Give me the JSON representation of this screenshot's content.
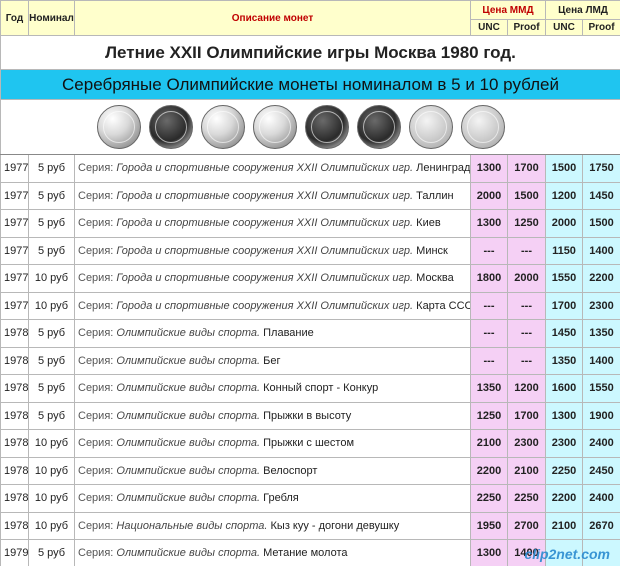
{
  "header": {
    "year": "Год",
    "nominal": "Номинал",
    "description": "Описание монет",
    "mmd_price": "Цена ММД",
    "lmd_price": "Цена ЛМД",
    "unc": "UNC",
    "proof": "Proof"
  },
  "title": "Летние XXII Олимпийские игры Москва 1980 год.",
  "subtitle": "Серебряные Олимпийские монеты номиналом в 5 и 10 рублей",
  "series_prefix": "Серия:",
  "rows": [
    {
      "year": "1977",
      "nominal": "5 руб",
      "series": "Города и спортивные сооружения XXII Олимпийских игр.",
      "name": "Ленинград",
      "mmd_unc": "1300",
      "mmd_proof": "1700",
      "lmd_unc": "1500",
      "lmd_proof": "1750"
    },
    {
      "year": "1977",
      "nominal": "5 руб",
      "series": "Города и спортивные сооружения XXII Олимпийских игр.",
      "name": "Таллин",
      "mmd_unc": "2000",
      "mmd_proof": "1500",
      "lmd_unc": "1200",
      "lmd_proof": "1450"
    },
    {
      "year": "1977",
      "nominal": "5 руб",
      "series": "Города и спортивные сооружения XXII Олимпийских игр.",
      "name": "Киев",
      "mmd_unc": "1300",
      "mmd_proof": "1250",
      "lmd_unc": "2000",
      "lmd_proof": "1500"
    },
    {
      "year": "1977",
      "nominal": "5 руб",
      "series": "Города и спортивные сооружения XXII Олимпийских игр.",
      "name": "Минск",
      "mmd_unc": "---",
      "mmd_proof": "---",
      "lmd_unc": "1150",
      "lmd_proof": "1400"
    },
    {
      "year": "1977",
      "nominal": "10 руб",
      "series": "Города и спортивные сооружения XXII Олимпийских игр.",
      "name": "Москва",
      "mmd_unc": "1800",
      "mmd_proof": "2000",
      "lmd_unc": "1550",
      "lmd_proof": "2200"
    },
    {
      "year": "1977",
      "nominal": "10 руб",
      "series": "Города и спортивные сооружения XXII Олимпийских игр.",
      "name": "Карта СССР",
      "mmd_unc": "---",
      "mmd_proof": "---",
      "lmd_unc": "1700",
      "lmd_proof": "2300"
    },
    {
      "year": "1978",
      "nominal": "5 руб",
      "series": "Олимпийские виды спорта.",
      "name": "Плавание",
      "mmd_unc": "---",
      "mmd_proof": "---",
      "lmd_unc": "1450",
      "lmd_proof": "1350"
    },
    {
      "year": "1978",
      "nominal": "5 руб",
      "series": "Олимпийские виды спорта.",
      "name": "Бег",
      "mmd_unc": "---",
      "mmd_proof": "---",
      "lmd_unc": "1350",
      "lmd_proof": "1400"
    },
    {
      "year": "1978",
      "nominal": "5 руб",
      "series": "Олимпийские виды спорта.",
      "name": "Конный спорт - Конкур",
      "mmd_unc": "1350",
      "mmd_proof": "1200",
      "lmd_unc": "1600",
      "lmd_proof": "1550"
    },
    {
      "year": "1978",
      "nominal": "5 руб",
      "series": "Олимпийские виды спорта.",
      "name": "Прыжки в высоту",
      "mmd_unc": "1250",
      "mmd_proof": "1700",
      "lmd_unc": "1300",
      "lmd_proof": "1900"
    },
    {
      "year": "1978",
      "nominal": "10 руб",
      "series": "Олимпийские виды спорта.",
      "name": "Прыжки с шестом",
      "mmd_unc": "2100",
      "mmd_proof": "2300",
      "lmd_unc": "2300",
      "lmd_proof": "2400"
    },
    {
      "year": "1978",
      "nominal": "10 руб",
      "series": "Олимпийские виды спорта.",
      "name": "Велоспорт",
      "mmd_unc": "2200",
      "mmd_proof": "2100",
      "lmd_unc": "2250",
      "lmd_proof": "2450"
    },
    {
      "year": "1978",
      "nominal": "10 руб",
      "series": "Олимпийские виды спорта.",
      "name": "Гребля",
      "mmd_unc": "2250",
      "mmd_proof": "2250",
      "lmd_unc": "2200",
      "lmd_proof": "2400"
    },
    {
      "year": "1978",
      "nominal": "10 руб",
      "series": "Национальные виды спорта.",
      "name": "Кыз куу - догони девушку",
      "mmd_unc": "1950",
      "mmd_proof": "2700",
      "lmd_unc": "2100",
      "lmd_proof": "2670"
    },
    {
      "year": "1979",
      "nominal": "5 руб",
      "series": "Олимпийские виды спорта.",
      "name": "Метание молота",
      "mmd_unc": "1300",
      "mmd_proof": "1400",
      "lmd_unc": "",
      "lmd_proof": ""
    }
  ],
  "coin_images": [
    "coin-1",
    "coin-2",
    "coin-3",
    "coin-4",
    "coin-5",
    "coin-6",
    "coin-7",
    "coin-8"
  ],
  "watermark": "clip2net.com",
  "colors": {
    "mmd_bg": "#f5d0f5",
    "lmd_bg": "#ccf8ff",
    "subtitle_bg": "#1fc5f0",
    "header_bg": "#ffffcc",
    "header_red": "#c00000"
  }
}
